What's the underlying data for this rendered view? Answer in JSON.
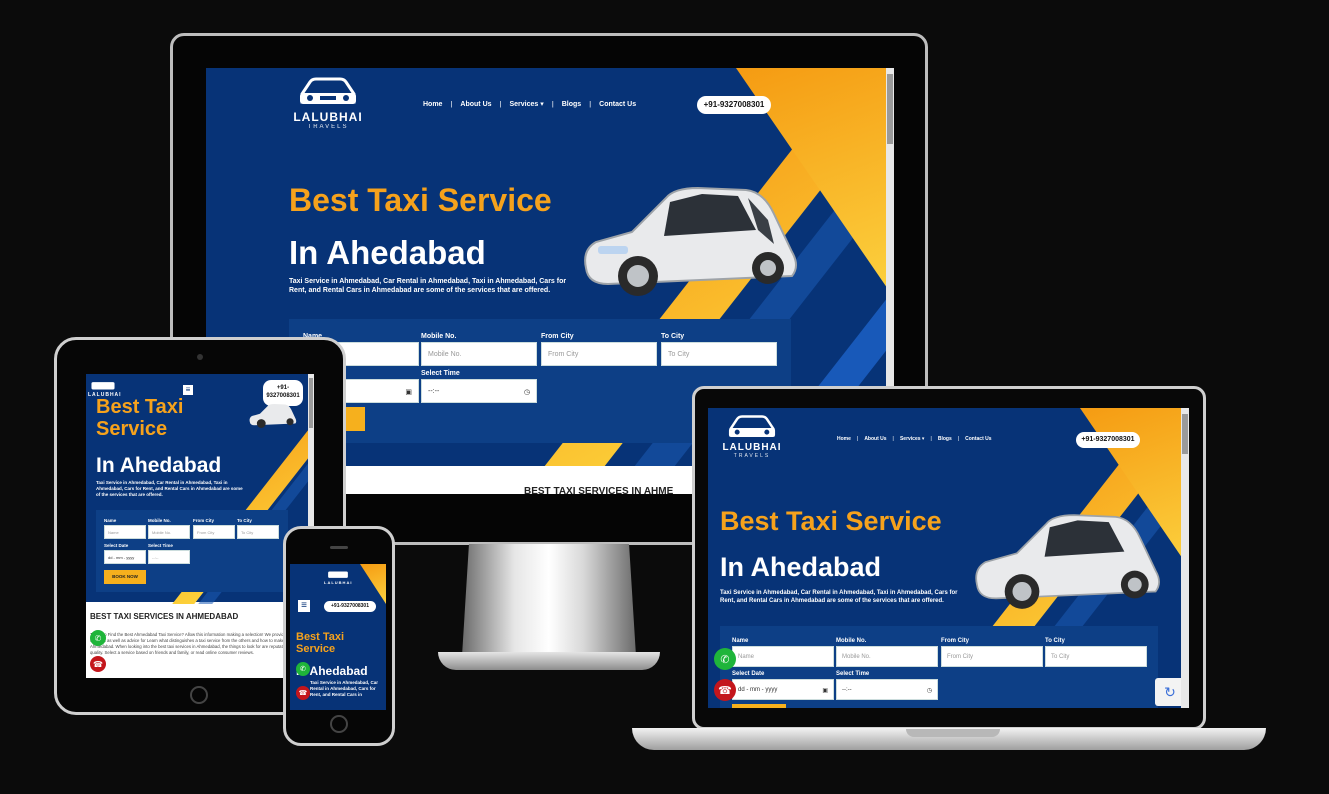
{
  "site": {
    "logo_name": "LALUBHAI",
    "logo_sub": "TRAVELS",
    "nav": [
      "Home",
      "About Us",
      "Services",
      "Blogs",
      "Contact Us"
    ],
    "phone": "+91-9327008301",
    "phone_short_line1": "+91-",
    "phone_short_line2": "9327008301",
    "hero_title": "Best Taxi Service",
    "hero_title_line1": "Best Taxi",
    "hero_title_line2": "Service",
    "hero_sub": "In Ahedabad",
    "hero_desc": "Taxi Service in Ahmedabad, Car Rental in Ahmedabad, Taxi in Ahmedabad, Cars for Rent, and Rental Cars in Ahmedabad are some of the services that are offered.",
    "form": {
      "name_label": "Name",
      "mobile_label": "Mobile No.",
      "from_label": "From City",
      "to_label": "To City",
      "date_label": "Select Date",
      "time_label": "Select Time",
      "name_ph": "Name",
      "mobile_ph": "Mobile No.",
      "from_ph": "From City",
      "to_ph": "To City",
      "date_ph": "dd - mm - yyyy",
      "time_ph": "--:--",
      "book_label": "BOOK NOW"
    },
    "section_title": "BEST TAXI SERVICES IN AHMEDABAD",
    "section_title_cut": "BEST TAXI SERVICES IN AHME",
    "section_text": "Trying to Find the Best Ahmedabad Taxi Service? Allow this information making a selection! We provide dependable services as well as advice for Learn what distinguishes a taxi service from the others and how to make the most Ahmedabad. When looking into the best taxi services in Ahmedabad, the things to look for are reputation and quality. Select a service based on friends and family, or read online consumer reviews.",
    "hero_desc_phone": "Taxi Service in Ahmedabad, Car Rental in Ahmedabad, Cars for Rent, and Rental Cars in"
  },
  "colors": {
    "page_bg": "#0b0b0b",
    "site_blue": "#073377",
    "accent_orange": "#f6a21c",
    "whatsapp_green": "#1fb53a",
    "call_red": "#c4161c"
  },
  "icons": [
    "car-logo-icon",
    "chevron-down-icon",
    "calendar-icon",
    "clock-icon",
    "whatsapp-icon",
    "phone-icon",
    "hamburger-icon"
  ]
}
